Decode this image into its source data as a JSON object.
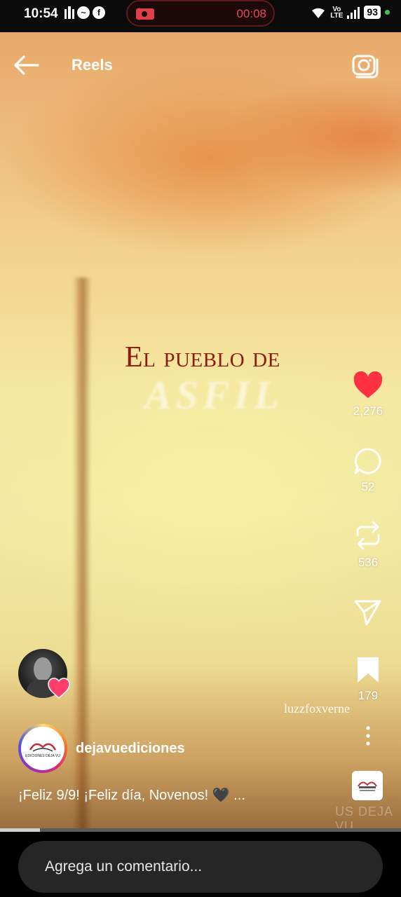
{
  "status_bar": {
    "time": "10:54",
    "recording_time": "00:08",
    "network_label_top": "Vo",
    "network_label_bottom": "LTE",
    "battery": "93"
  },
  "header": {
    "title": "Reels",
    "back_icon": "arrow-left-icon",
    "camera_icon": "camera-icon"
  },
  "video": {
    "title_line1": "El pueblo de",
    "title_line2": "ASFIL",
    "watermark": "luzzfoxverne",
    "watermark2": "US DEJA VU"
  },
  "actions": {
    "likes": "2,276",
    "comments": "52",
    "reposts": "536",
    "saves": "179",
    "like_color": "#ff3040"
  },
  "post": {
    "author": "dejavuediciones",
    "author_logo_text": "EDICIONES DEJA VU",
    "caption": "¡Feliz 9/9! ¡Feliz día, Novenos! 🖤 ..."
  },
  "progress_percent": 10,
  "comment": {
    "placeholder": "Agrega un comentario..."
  }
}
